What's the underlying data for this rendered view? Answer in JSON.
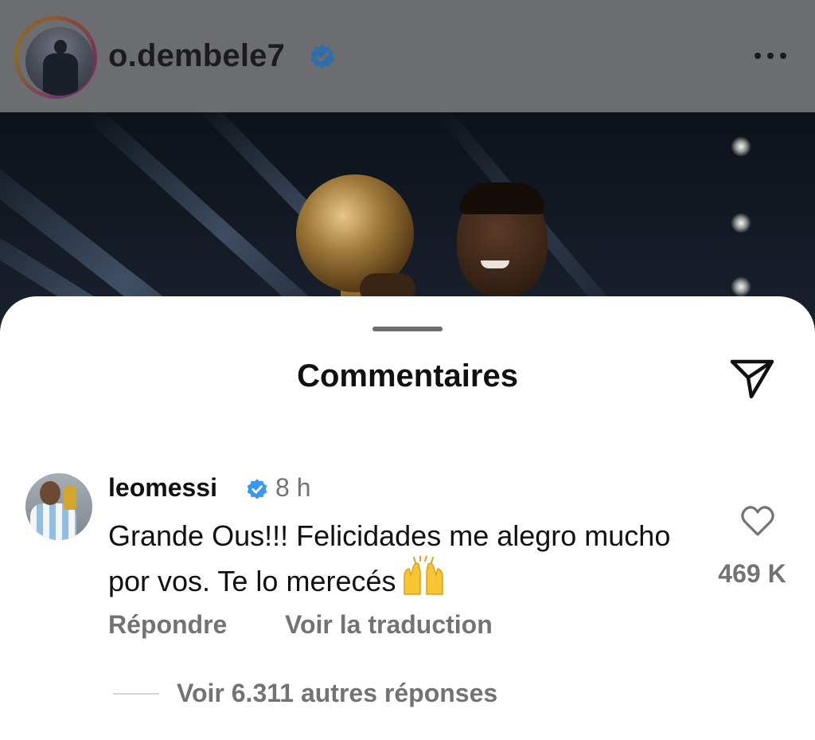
{
  "post": {
    "username": "o.dembele7",
    "verified_icon": "verified-badge-icon",
    "more_icon": "more-horizontal-icon"
  },
  "comments_sheet": {
    "title": "Commentaires",
    "share_icon": "send-icon"
  },
  "comment": {
    "username": "leomessi",
    "verified_icon": "verified-badge-icon",
    "time": "8 h",
    "text": "Grande Ous!!! Felicidades me alegro mucho por vos. Te lo merecés",
    "emoji": "🙌",
    "like_icon": "heart-outline-icon",
    "like_count": "469 K",
    "reply_label": "Répondre",
    "translate_label": "Voir la traduction",
    "view_replies_label": "Voir 6.311 autres réponses"
  },
  "colors": {
    "verified_blue": "#3897f0",
    "secondary_text": "#737373",
    "primary_text": "#111111",
    "dim_overlay": "#6c6d70"
  }
}
